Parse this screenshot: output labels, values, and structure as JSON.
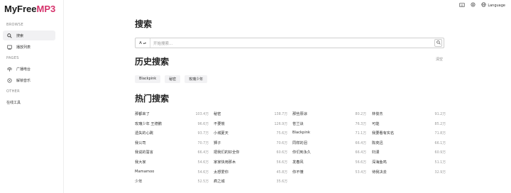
{
  "app": {
    "logo_part1": "MyFree",
    "logo_part2": "MP3",
    "accent_color": "#d6336c"
  },
  "topbar": {
    "language_label": "Language",
    "icons": [
      "keyboard-icon",
      "settings-icon",
      "globe-icon"
    ]
  },
  "sidebar": {
    "browse_label": "BROWSE",
    "items_browse": [
      {
        "label": "搜索",
        "icon": "search-icon",
        "active": true
      },
      {
        "label": "播放列表",
        "icon": "playlist-icon",
        "active": false
      }
    ],
    "pages_label": "PAGES",
    "items_pages": [
      {
        "label": "广播电台",
        "icon": "radio-icon"
      },
      {
        "label": "解锁音乐",
        "icon": "unlock-icon"
      }
    ],
    "other_label": "OTHER",
    "items_other": [
      {
        "label": "在线工具"
      }
    ]
  },
  "main": {
    "search_title": "搜索",
    "search_type": "A",
    "search_placeholder": "开始搜索...",
    "history_title": "历史搜索",
    "clear_label": "清空",
    "history": [
      "Blackpink",
      "秘密",
      "玫瑰少年"
    ],
    "hot_title": "热门搜索",
    "hot": [
      [
        {
          "t": "那都来了",
          "c": "103.4万"
        },
        {
          "t": "玫瑰少年 王德鹏",
          "c": "96.6万"
        },
        {
          "t": "遗失的心跳",
          "c": "93.7万"
        },
        {
          "t": "我公司",
          "c": "70.7万"
        },
        {
          "t": "我说的誓言",
          "c": "66.4万"
        },
        {
          "t": "我大家",
          "c": "54.6万"
        },
        {
          "t": "Mamamoo",
          "c": "54.6万"
        },
        {
          "t": "少年",
          "c": "52.5万"
        }
      ],
      [
        {
          "t": "秘密",
          "c": "138.7万"
        },
        {
          "t": "不要慌",
          "c": "126.9万"
        },
        {
          "t": "小城夏天",
          "c": "75.6万"
        },
        {
          "t": "狮子",
          "c": "70.6万"
        },
        {
          "t": "把我们的好全你",
          "c": "60.6万"
        },
        {
          "t": "家家快用那木",
          "c": "56.6万"
        },
        {
          "t": "太想爱你",
          "c": "45.8万"
        },
        {
          "t": "疯之城",
          "c": "35.6万"
        }
      ],
      [
        {
          "t": "那些原谅",
          "c": "80.2万"
        },
        {
          "t": "苍兰诀",
          "c": "76.3万"
        },
        {
          "t": "Blackpink",
          "c": "71.1万"
        },
        {
          "t": "同样的泪",
          "c": "66.4万"
        },
        {
          "t": "你们到永久",
          "c": "66.4万"
        },
        {
          "t": "发春风",
          "c": "56.6万"
        },
        {
          "t": "你不懂",
          "c": "53.4万"
        }
      ],
      [
        {
          "t": "林俊杰",
          "c": "91.2万"
        },
        {
          "t": "可能",
          "c": "85.2万"
        },
        {
          "t": "我要看有实名",
          "c": "71.8万"
        },
        {
          "t": "陈奕迅",
          "c": "66.1万"
        },
        {
          "t": "妇漫",
          "c": "60.9万"
        },
        {
          "t": "深海鱼鸣",
          "c": "51.1万"
        },
        {
          "t": "待我决去",
          "c": "32.9万"
        }
      ]
    ]
  }
}
